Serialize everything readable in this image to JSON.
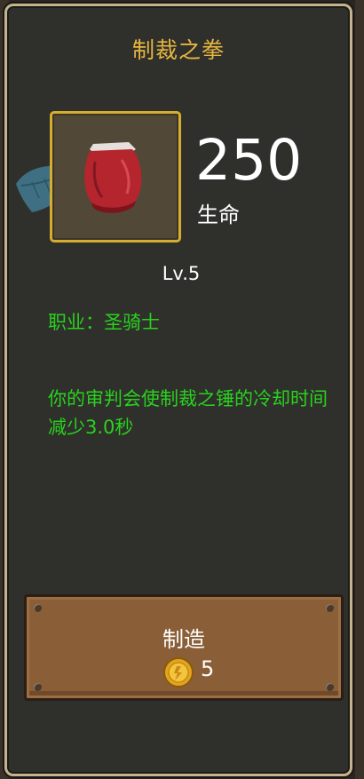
{
  "item": {
    "title": "制裁之拳",
    "stat_value": "250",
    "stat_label": "生命",
    "level": "Lv.5",
    "class_line": "职业：圣骑士",
    "description": "你的审判会使制裁之锤的冷却时间减少3.0秒"
  },
  "craft": {
    "label": "制造",
    "cost": "5",
    "currency_icon": "gold-coin-icon"
  },
  "colors": {
    "title": "#e7b640",
    "green_text": "#29d21e",
    "frame_border": "#d6ae2f",
    "panel_border": "#c4b48e",
    "button_wood": "#8a5f38"
  }
}
